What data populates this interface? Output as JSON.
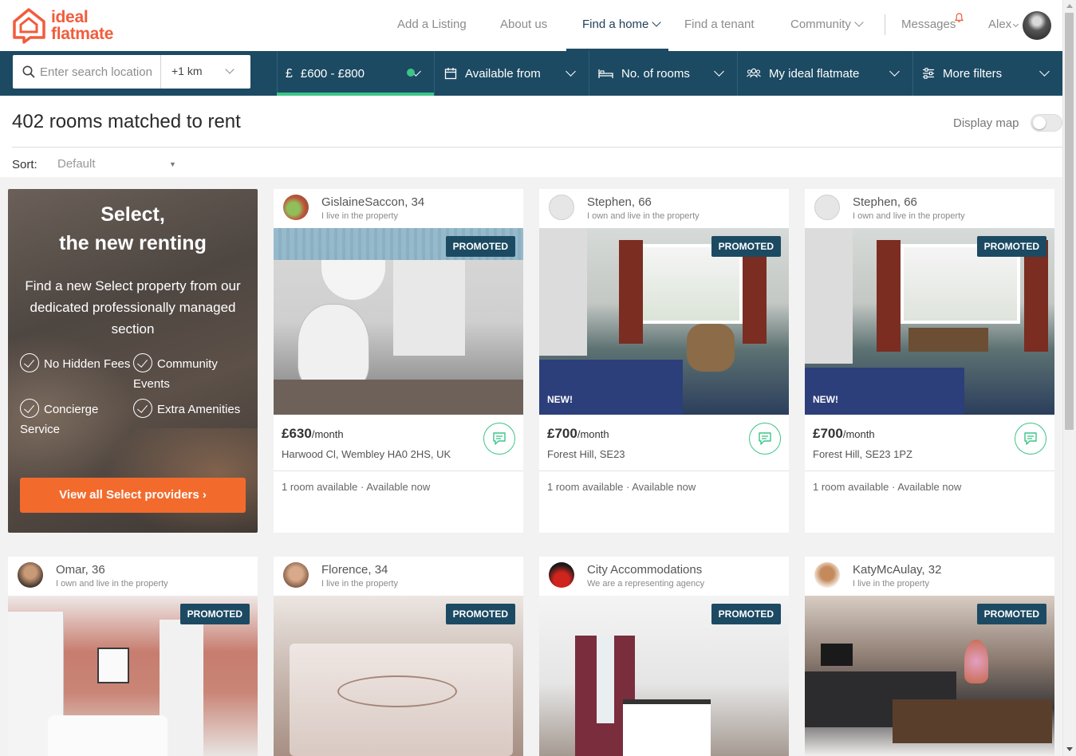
{
  "brand": {
    "logo_line1": "ideal",
    "logo_line2": "flatmate",
    "accent": "#f25c3b",
    "navy": "#1c4a63",
    "green": "#3cc487",
    "orange": "#f26b2d"
  },
  "nav": {
    "add_listing": "Add a Listing",
    "about": "About us",
    "find_home": "Find a home",
    "find_tenant": "Find a tenant",
    "community": "Community",
    "messages": "Messages",
    "user": "Alex"
  },
  "filters": {
    "search_placeholder": "Enter search location",
    "radius": "+1 km",
    "price": "£600 - £800",
    "available_from": "Available from",
    "rooms": "No. of rooms",
    "flatmate": "My ideal flatmate",
    "more": "More filters"
  },
  "results": {
    "title": "402 rooms matched to rent",
    "display_map": "Display map",
    "sort_label": "Sort:",
    "sort_value": "Default"
  },
  "promo": {
    "title_line1": "Select,",
    "title_line2": "the new renting",
    "subtitle": "Find a new Select property from our dedicated professionally managed section",
    "features": [
      "No Hidden Fees",
      "Community Events",
      "Concierge Service",
      "Extra Amenities"
    ],
    "button": "View all Select providers ›"
  },
  "listings": [
    {
      "name": "GislaineSaccon, 34",
      "role": "I live in the property",
      "badge": "PROMOTED",
      "new": "",
      "price": "£630",
      "per": "/month",
      "address": "Harwood Cl, Wembley HA0 2HS, UK",
      "availability": "1 room available · Available now"
    },
    {
      "name": "Stephen, 66",
      "role": "I own and live in the property",
      "badge": "PROMOTED",
      "new": "NEW!",
      "price": "£700",
      "per": "/month",
      "address": "Forest Hill, SE23",
      "availability": "1 room available · Available now"
    },
    {
      "name": "Stephen, 66",
      "role": "I own and live in the property",
      "badge": "PROMOTED",
      "new": "NEW!",
      "price": "£700",
      "per": "/month",
      "address": "Forest Hill, SE23 1PZ",
      "availability": "1 room available · Available now"
    },
    {
      "name": "Omar, 36",
      "role": "I own and live in the property",
      "badge": "PROMOTED"
    },
    {
      "name": "Florence, 34",
      "role": "I live in the property",
      "badge": "PROMOTED"
    },
    {
      "name": "City Accommodations",
      "role": "We are a representing agency",
      "badge": "PROMOTED"
    },
    {
      "name": "KatyMcAulay, 32",
      "role": "I live in the property",
      "badge": "PROMOTED"
    }
  ]
}
